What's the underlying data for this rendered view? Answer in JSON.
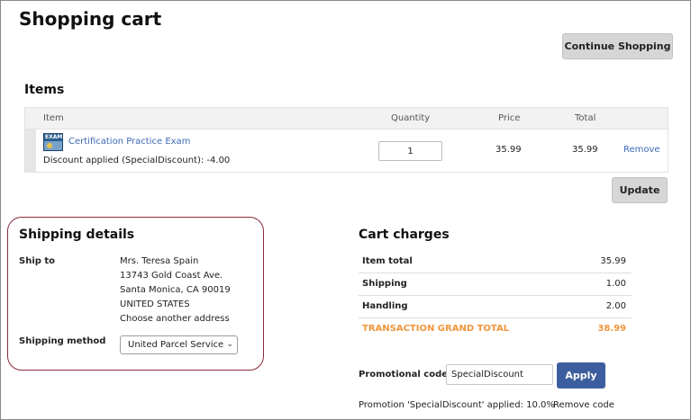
{
  "page": {
    "title": "Shopping cart"
  },
  "buttons": {
    "continue_shopping": "Continue Shopping",
    "update": "Update",
    "apply": "Apply"
  },
  "items": {
    "title": "Items",
    "columns": {
      "item": "Item",
      "quantity": "Quantity",
      "price": "Price",
      "total": "Total"
    },
    "rows": [
      {
        "icon": "exam-product-icon",
        "icon_label": "EXAM",
        "name": "Certification Practice Exam",
        "discount": "Discount applied (SpecialDiscount): -4.00",
        "quantity": "1",
        "price": "35.99",
        "total": "35.99",
        "remove": "Remove"
      }
    ]
  },
  "shipping": {
    "title": "Shipping details",
    "ship_to_label": "Ship to",
    "address": {
      "name": "Mrs. Teresa Spain",
      "street": "13743 Gold Coast Ave.",
      "city": "Santa Monica, CA 90019",
      "country": "UNITED STATES"
    },
    "choose_address": "Choose another address",
    "method_label": "Shipping method",
    "method_value": "United Parcel Service",
    "highlight_color": "#8b2a3b"
  },
  "charges": {
    "title": "Cart charges",
    "rows": [
      {
        "label": "Item total",
        "value": "35.99"
      },
      {
        "label": "Shipping",
        "value": "1.00"
      },
      {
        "label": "Handling",
        "value": "2.00"
      }
    ],
    "grand_total": {
      "label": "TRANSACTION GRAND TOTAL",
      "value": "38.99",
      "color": "#f0953c"
    }
  },
  "promo": {
    "label": "Promotional code",
    "value": "SpecialDiscount",
    "applied_text": "Promotion 'SpecialDiscount' applied: 10.0%",
    "remove_code": "Remove code"
  },
  "colors": {
    "link": "#3e6bb5",
    "apply_button": "#3d5e9e",
    "grey_button": "#d6d6d6"
  }
}
